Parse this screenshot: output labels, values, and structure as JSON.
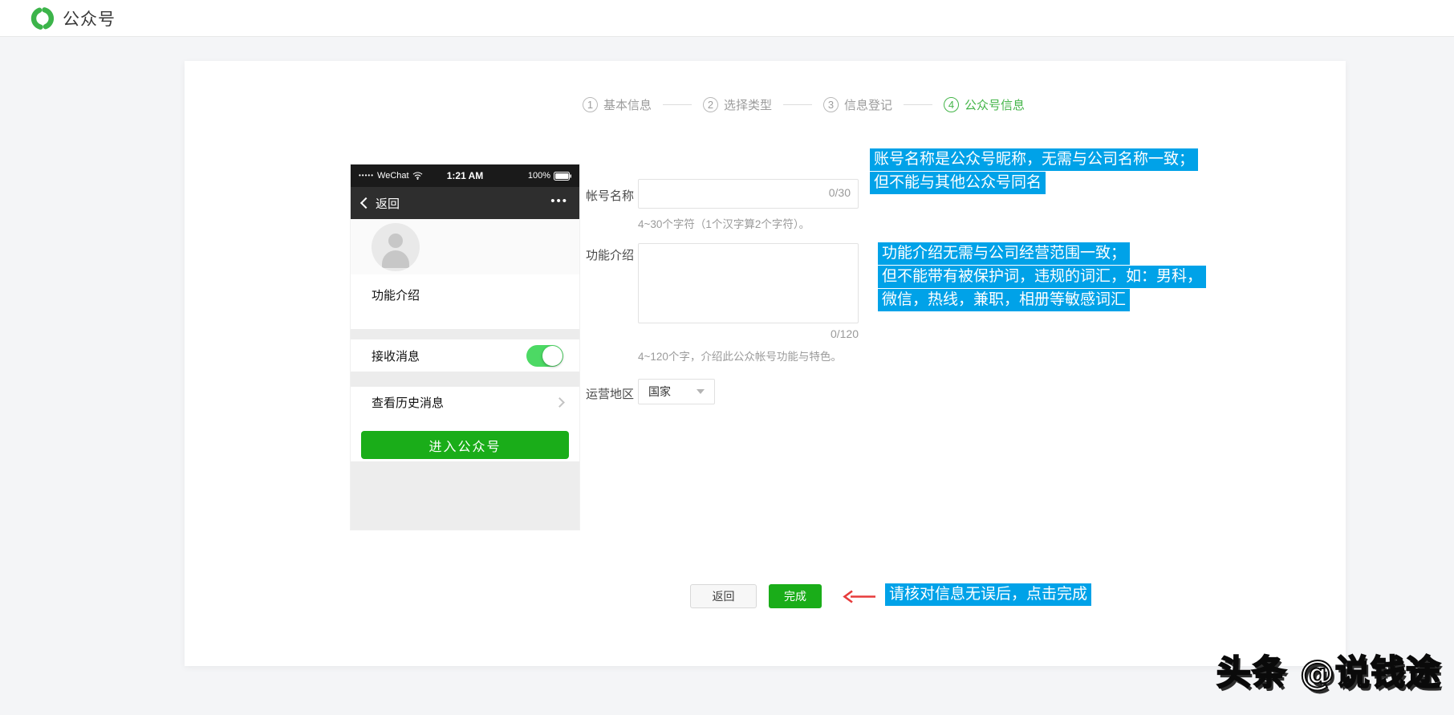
{
  "header": {
    "brand": "公众号"
  },
  "steps": [
    {
      "num": "1",
      "label": "基本信息"
    },
    {
      "num": "2",
      "label": "选择类型"
    },
    {
      "num": "3",
      "label": "信息登记"
    },
    {
      "num": "4",
      "label": "公众号信息"
    }
  ],
  "phone": {
    "carrier_dots": "•••••",
    "carrier": "WeChat",
    "time": "1:21 AM",
    "battery": "100%",
    "back": "返回",
    "more": "•••",
    "intro_label": "功能介绍",
    "receive_row": "接收消息",
    "history_row": "查看历史消息",
    "enter_button": "进入公众号"
  },
  "form": {
    "name": {
      "label": "帐号名称",
      "value": "",
      "counter": "0/30",
      "hint": "4~30个字符（1个汉字算2个字符）。"
    },
    "intro": {
      "label": "功能介绍",
      "value": "",
      "counter": "0/120",
      "hint": "4~120个字，介绍此公众帐号功能与特色。"
    },
    "region": {
      "label": "运营地区",
      "value": "国家"
    }
  },
  "annotations": {
    "name_note": [
      "账号名称是公众号昵称，无需与公司名称一致；",
      "但不能与其他公众号同名"
    ],
    "intro_note": [
      "功能介绍无需与公司经营范围一致；",
      "但不能带有被保护词，违规的词汇，如：男科，",
      "微信，热线，兼职，相册等敏感词汇"
    ],
    "finish_note": "请核对信息无误后，点击完成"
  },
  "actions": {
    "back": "返回",
    "finish": "完成"
  },
  "watermark": "头条 @说钱途",
  "colors": {
    "accent_green": "#1aad19",
    "step_active_green": "#44b549",
    "highlight_blue": "#00a2e8",
    "arrow_red": "#e73c3c",
    "toggle_green": "#4cd964",
    "logo_green": "#3cb44a"
  }
}
